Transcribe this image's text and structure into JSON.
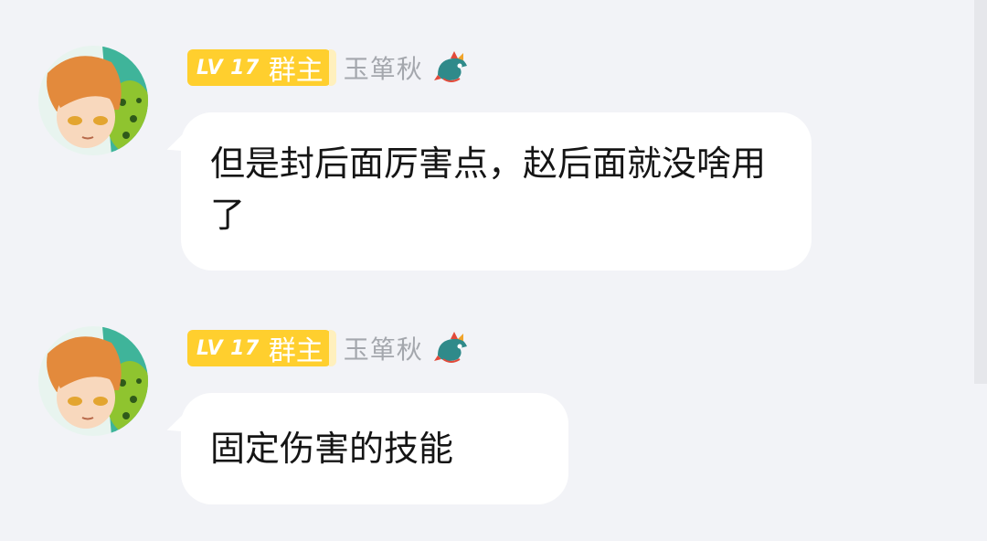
{
  "messages": [
    {
      "level": "LV 17",
      "role": "群主",
      "username": "玉箪秋",
      "avatar_icon": "anime-boy-avatar",
      "title_icon": "dragon-icon",
      "text": "但是封后面厉害点，赵后面就没啥用了"
    },
    {
      "level": "LV 17",
      "role": "群主",
      "username": "玉箪秋",
      "avatar_icon": "anime-boy-avatar",
      "title_icon": "dragon-icon",
      "text": "固定伤害的技能"
    }
  ],
  "colors": {
    "background": "#f2f3f7",
    "badge": "#ffcf2e",
    "username": "#a4a7ad",
    "bubble": "#ffffff"
  }
}
